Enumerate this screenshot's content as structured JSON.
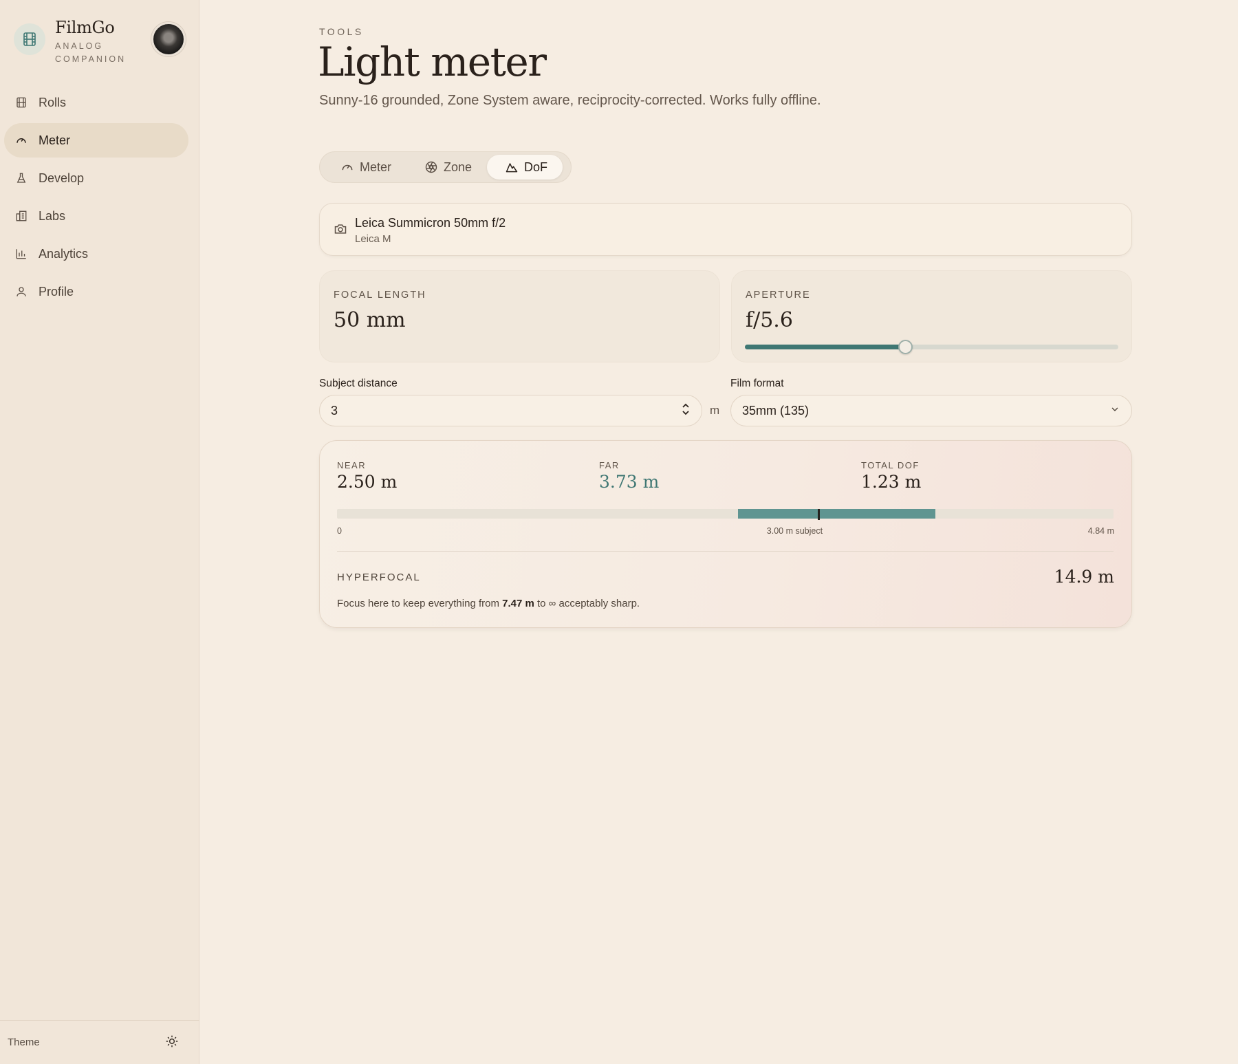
{
  "app": {
    "name": "FilmGo",
    "tagline": "ANALOG COMPANION"
  },
  "sidebar": {
    "items": [
      {
        "label": "Rolls",
        "icon": "film-icon",
        "active": false
      },
      {
        "label": "Meter",
        "icon": "gauge-icon",
        "active": true
      },
      {
        "label": "Develop",
        "icon": "flask-icon",
        "active": false
      },
      {
        "label": "Labs",
        "icon": "building-icon",
        "active": false
      },
      {
        "label": "Analytics",
        "icon": "bar-chart-icon",
        "active": false
      },
      {
        "label": "Profile",
        "icon": "user-icon",
        "active": false
      }
    ],
    "theme_label": "Theme"
  },
  "header": {
    "eyebrow": "TOOLS",
    "title": "Light meter",
    "subtitle": "Sunny-16 grounded, Zone System aware, reciprocity-corrected. Works fully offline."
  },
  "tabs": [
    {
      "label": "Meter",
      "icon": "gauge-icon",
      "active": false
    },
    {
      "label": "Zone",
      "icon": "aperture-icon",
      "active": false
    },
    {
      "label": "DoF",
      "icon": "mountain-icon",
      "active": true
    }
  ],
  "lens": {
    "name": "Leica Summicron 50mm f/2",
    "mount": "Leica M"
  },
  "focal_length": {
    "label": "FOCAL LENGTH",
    "value": "50 mm"
  },
  "aperture": {
    "label": "APERTURE",
    "value": "f/5.6",
    "slider_fraction": 0.43
  },
  "subject_distance": {
    "label": "Subject distance",
    "value": "3",
    "unit": "m"
  },
  "film_format": {
    "label": "Film format",
    "value": "35mm (135)"
  },
  "results": {
    "near": {
      "label": "NEAR",
      "value": "2.50 m"
    },
    "far": {
      "label": "FAR",
      "value": "3.73 m"
    },
    "total": {
      "label": "TOTAL DOF",
      "value": "1.23 m"
    },
    "scale": {
      "min_label": "0",
      "subject_label": "3.00 m subject",
      "max_label": "4.84 m",
      "min": 0,
      "max": 4.84,
      "near": 2.5,
      "far": 3.73,
      "subject": 3.0
    },
    "hyperfocal": {
      "label": "HYPERFOCAL",
      "value": "14.9 m",
      "note_prefix": "Focus here to keep everything from ",
      "note_bold": "7.47 m",
      "note_suffix": " to ∞ acceptably sharp."
    }
  },
  "colors": {
    "accent": "#3f7773",
    "far_value": "#3f7773",
    "range": "#5f9591"
  }
}
